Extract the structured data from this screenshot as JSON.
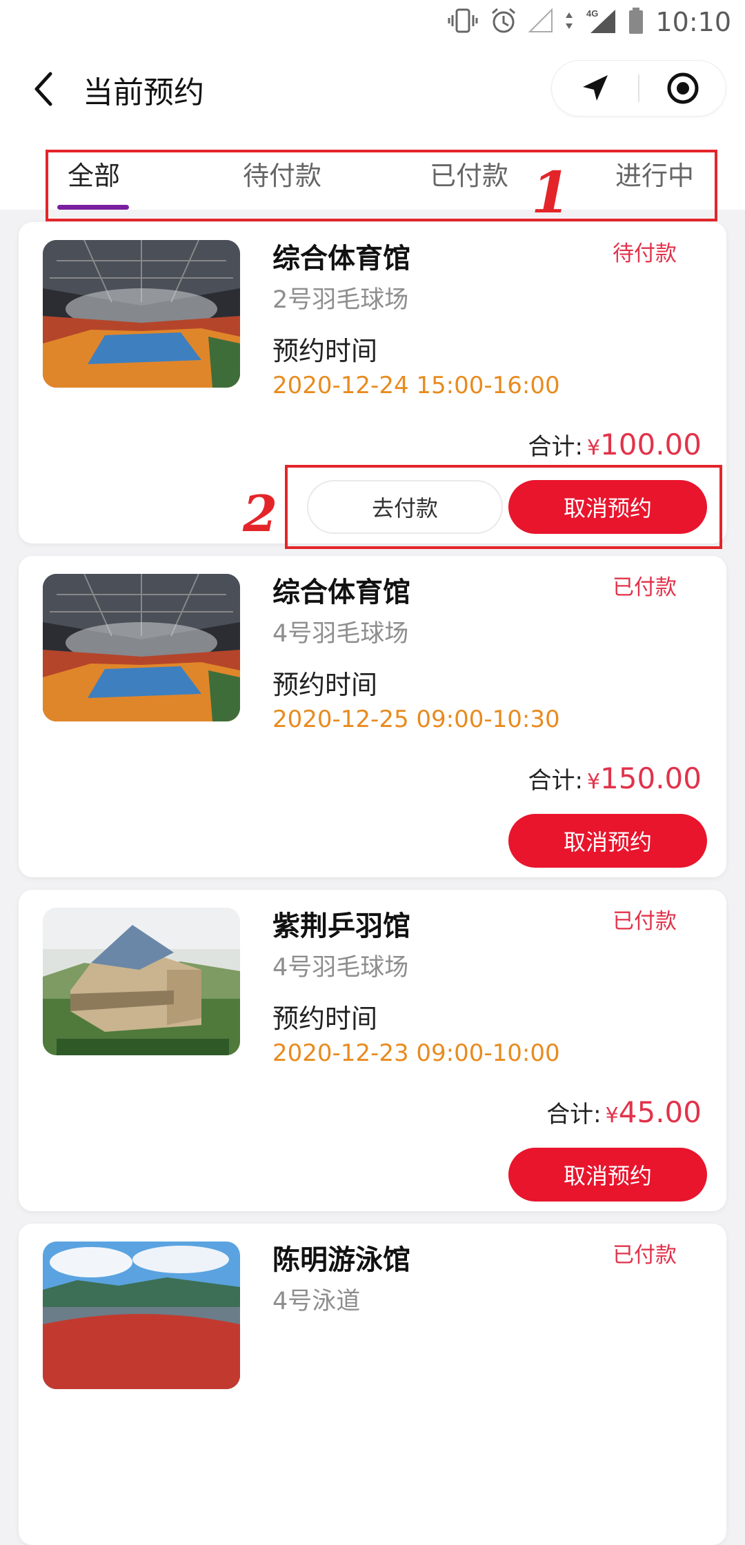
{
  "status_bar": {
    "time": "10:10",
    "network": "4G"
  },
  "header": {
    "title": "当前预约"
  },
  "tabs": [
    {
      "label": "全部",
      "active": true
    },
    {
      "label": "待付款",
      "active": false
    },
    {
      "label": "已付款",
      "active": false
    },
    {
      "label": "进行中",
      "active": false
    }
  ],
  "annotations": {
    "marker1": "1",
    "marker2": "2"
  },
  "common": {
    "time_label": "预约时间",
    "total_label": "合计:",
    "currency": "¥",
    "pay_label": "去付款",
    "cancel_label": "取消预约"
  },
  "bookings": [
    {
      "venue": "综合体育馆",
      "court": "2号羽毛球场",
      "status": "待付款",
      "time": "2020-12-24 15:00-16:00",
      "amount": "100.00",
      "image": "arena"
    },
    {
      "venue": "综合体育馆",
      "court": "4号羽毛球场",
      "status": "已付款",
      "time": "2020-12-25 09:00-10:30",
      "amount": "150.00",
      "image": "arena"
    },
    {
      "venue": "紫荆乒羽馆",
      "court": "4号羽毛球场",
      "status": "已付款",
      "time": "2020-12-23 09:00-10:00",
      "amount": "45.00",
      "image": "building"
    },
    {
      "venue": "陈明游泳馆",
      "court": "4号泳道",
      "status": "已付款",
      "time": "",
      "amount": "",
      "image": "stadium"
    }
  ],
  "colors": {
    "accent": "#e8152d",
    "status": "#e1334b",
    "time": "#e88b1f",
    "tab_underline": "#7a1fa0",
    "annotation": "#e3252a"
  }
}
